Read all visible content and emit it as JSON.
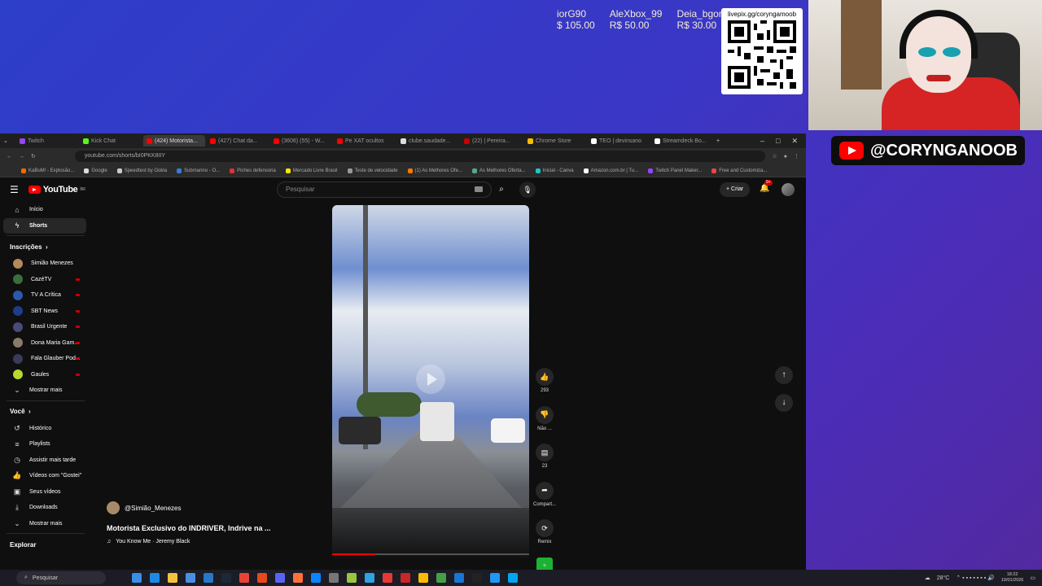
{
  "overlay": {
    "donors": [
      {
        "name": "iorG90",
        "amount": "$ 105.00"
      },
      {
        "name": "AleXbox_99",
        "amount": "R$ 50.00"
      },
      {
        "name": "Deia_bgon",
        "amount": "R$ 30.00"
      }
    ],
    "qr_label": "livepix.gg/coryngamoob",
    "channel_badge": "@CORYNGANOOB"
  },
  "browser": {
    "url": "youtube.com/shorts/bI0PKK8IIY",
    "tabs": [
      "Twitch",
      "Kick Chat",
      "(424) Motorista...",
      "(427) Chat da...",
      "(3606) (55) - W...",
      "Pe XAT ocultos",
      "clube.saudade...",
      "(22) | Pereira...",
      "Chrome Store",
      "TEO | devinsano",
      "Streamdeck Bo..."
    ],
    "bookmarks": [
      "KaBuM! - Explosão...",
      "Google",
      "Speedtest by Ookla",
      "Submarino - O...",
      "Piches defensoria",
      "Mercado Livre Brasil",
      "Teste de velocidade",
      "(1) As Melhores Ofe...",
      "As Melhores Oferta...",
      "Inicial - Canva",
      "Amazon.com.br | Tu...",
      "Twitch Panel Maker...",
      "Free and Customiza..."
    ]
  },
  "youtube": {
    "logo": "YouTube",
    "logo_region": "BR",
    "search_placeholder": "Pesquisar",
    "create_label": "Criar",
    "notif_count": "9+",
    "nav": [
      {
        "label": "Início",
        "icon": "home-icon"
      },
      {
        "label": "Shorts",
        "icon": "shorts-icon"
      }
    ],
    "subs_title": "Inscrições",
    "subs": [
      {
        "label": "Simião Menezes",
        "color": "#b58a5a",
        "live": false
      },
      {
        "label": "CazéTV",
        "color": "#3a6e3a",
        "live": true
      },
      {
        "label": "TV A Crítica",
        "color": "#2a5ab0",
        "live": true
      },
      {
        "label": "SBT News",
        "color": "#1e3c8a",
        "live": true
      },
      {
        "label": "Brasil Urgente",
        "color": "#4a4a7a",
        "live": true
      },
      {
        "label": "Dona Maria Gam...",
        "color": "#8a7a6a",
        "live": true
      },
      {
        "label": "Fala Glauber Pod...",
        "color": "#3a3a5a",
        "live": true
      },
      {
        "label": "Gaules",
        "color": "#b8d830",
        "live": true
      }
    ],
    "subs_more": "Mostrar mais",
    "you_title": "Você",
    "you": [
      {
        "label": "Histórico",
        "icon": "history-icon"
      },
      {
        "label": "Playlists",
        "icon": "playlist-icon"
      },
      {
        "label": "Assistir mais tarde",
        "icon": "clock-icon"
      },
      {
        "label": "Vídeos com \"Gostei\"",
        "icon": "thumbs-up-icon"
      },
      {
        "label": "Seus vídeos",
        "icon": "video-icon"
      },
      {
        "label": "Downloads",
        "icon": "download-icon"
      }
    ],
    "you_more": "Mostrar mais",
    "explore_title": "Explorar",
    "short": {
      "channel": "@Simião_Menezes",
      "title": "Motorista Exclusivo do INDRIVER, Indrive na ...",
      "song": "You Know Me · Jeremy Black",
      "likes": "293",
      "dislike_label": "Não ...",
      "comments": "23",
      "share_label": "Compart...",
      "remix_label": "Remix",
      "progress": 0.22
    }
  },
  "taskbar": {
    "search": "Pesquisar",
    "weather": "28°C",
    "time": "18:22",
    "date": "19/01/2026"
  }
}
